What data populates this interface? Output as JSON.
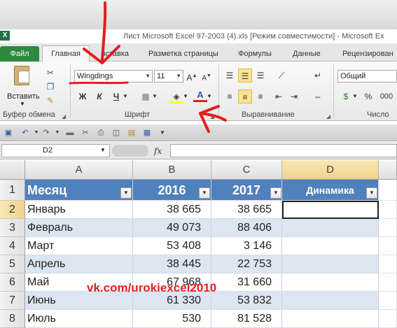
{
  "window": {
    "title": "Лист Microsoft Excel 97-2003 (4).xls  [Режим совместимости]  -  Microsoft Ex",
    "app_icon": "X"
  },
  "tabs": [
    {
      "label": "Файл",
      "active": false
    },
    {
      "label": "Главная",
      "active": true
    },
    {
      "label": "вставка",
      "active": false
    },
    {
      "label": "Разметка страницы",
      "active": false
    },
    {
      "label": "Формулы",
      "active": false
    },
    {
      "label": "Данные",
      "active": false
    },
    {
      "label": "Рецензирован",
      "active": false
    }
  ],
  "ribbon": {
    "clipboard": {
      "paste_label": "Вставить",
      "group_label": "Буфер обмена"
    },
    "font": {
      "font_name": "Wingdings",
      "font_size": "11",
      "bold": "Ж",
      "italic": "К",
      "underline": "Ч",
      "font_color_letter": "A",
      "group_label": "Шрифт"
    },
    "alignment": {
      "group_label": "Выравнивание"
    },
    "number": {
      "format": "Общий",
      "percent": "%",
      "thousands": "000",
      "group_label": "Число"
    }
  },
  "formula_bar": {
    "name_box": "D2",
    "fx_label": "fx",
    "formula": ""
  },
  "sheet": {
    "columns": [
      "A",
      "B",
      "C",
      "D"
    ],
    "rows": [
      "1",
      "2",
      "3",
      "4",
      "5",
      "6",
      "7",
      "8"
    ],
    "header": {
      "month": "Месяц",
      "y2016": "2016",
      "y2017": "2017",
      "dynamics": "Динамика"
    },
    "data": [
      {
        "month": "Январь",
        "y2016": "38 665",
        "y2017": "38 665"
      },
      {
        "month": "Февраль",
        "y2016": "49 073",
        "y2017": "88 406"
      },
      {
        "month": "Март",
        "y2016": "53 408",
        "y2017": "3 146"
      },
      {
        "month": "Апрель",
        "y2016": "38 445",
        "y2017": "22 753"
      },
      {
        "month": "Май",
        "y2016": "67 968",
        "y2017": "31 660"
      },
      {
        "month": "Июнь",
        "y2016": "61 330",
        "y2017": "53 832"
      },
      {
        "month": "Июль",
        "y2016": "530",
        "y2017": "81 528"
      }
    ]
  },
  "watermark": "vk.com/urokiexcel2010",
  "colors": {
    "table_header": "#4f81bd",
    "band": "#dce6f1",
    "file_tab": "#2c8a3f",
    "annotation_red": "#e41e1e"
  }
}
